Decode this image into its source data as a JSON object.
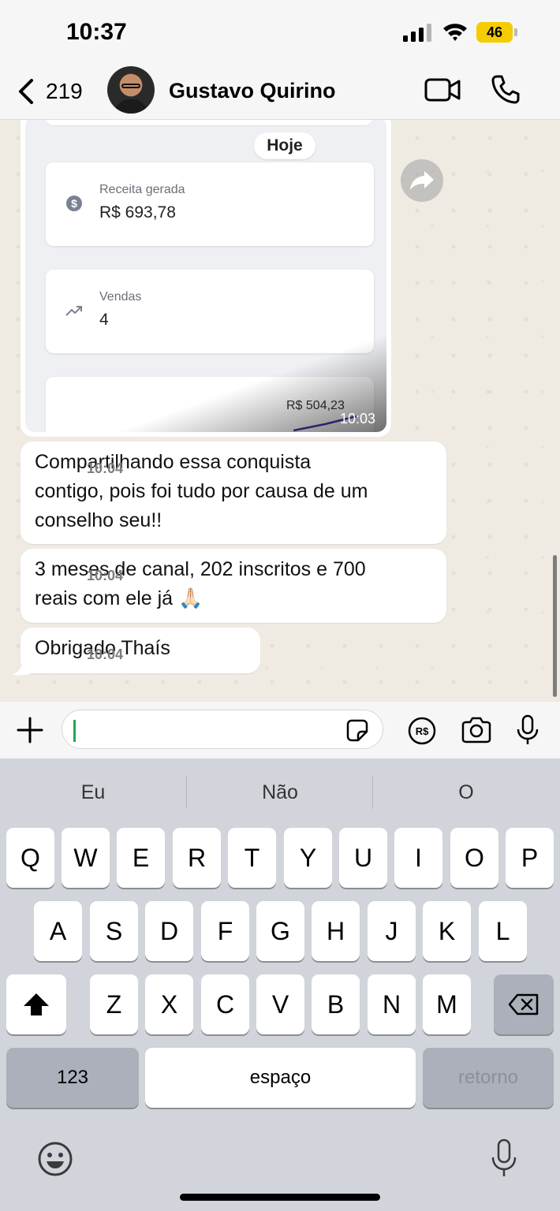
{
  "status_bar": {
    "time": "10:37",
    "battery": "46"
  },
  "header": {
    "back_count": "219",
    "contact_name": "Gustavo Quirino"
  },
  "chat": {
    "image_message": {
      "day_label": "Hoje",
      "revenue_label": "Receita gerada",
      "revenue_value": "R$ 693,78",
      "sales_label": "Vendas",
      "sales_value": "4",
      "chart_amount": "R$ 504,23",
      "time": "10:03"
    },
    "messages": [
      {
        "text": "Compartilhando essa conquista\ncontigo, pois foi tudo por causa de um\nconselho seu!!",
        "time": "10:04"
      },
      {
        "text": "3 meses de canal, 202 inscritos e 700\nreais com ele já 🙏🏻",
        "time": "10:04"
      },
      {
        "text": "Obrigado Thaís",
        "time": "10:04"
      }
    ]
  },
  "keyboard": {
    "suggestions": [
      "Eu",
      "Não",
      "O"
    ],
    "row1": [
      "Q",
      "W",
      "E",
      "R",
      "T",
      "Y",
      "U",
      "I",
      "O",
      "P"
    ],
    "row2": [
      "A",
      "S",
      "D",
      "F",
      "G",
      "H",
      "J",
      "K",
      "L"
    ],
    "row3": [
      "Z",
      "X",
      "C",
      "V",
      "B",
      "N",
      "M"
    ],
    "numbers_label": "123",
    "space_label": "espaço",
    "return_label": "retorno"
  },
  "icons": {
    "back": "chevron-left-icon",
    "video_call": "video-camera-icon",
    "voice_call": "phone-icon",
    "forward": "forward-icon",
    "attach": "plus-icon",
    "sticker": "sticker-icon",
    "payment": "brl-payment-icon",
    "camera": "camera-icon",
    "microphone": "microphone-icon",
    "shift": "shift-icon",
    "delete": "backspace-icon",
    "emoji": "emoji-icon",
    "dictation": "dictation-mic-icon"
  },
  "colors": {
    "accent_green": "#1fa855",
    "chat_background": "#efeae2",
    "battery": "#f5cc00"
  }
}
